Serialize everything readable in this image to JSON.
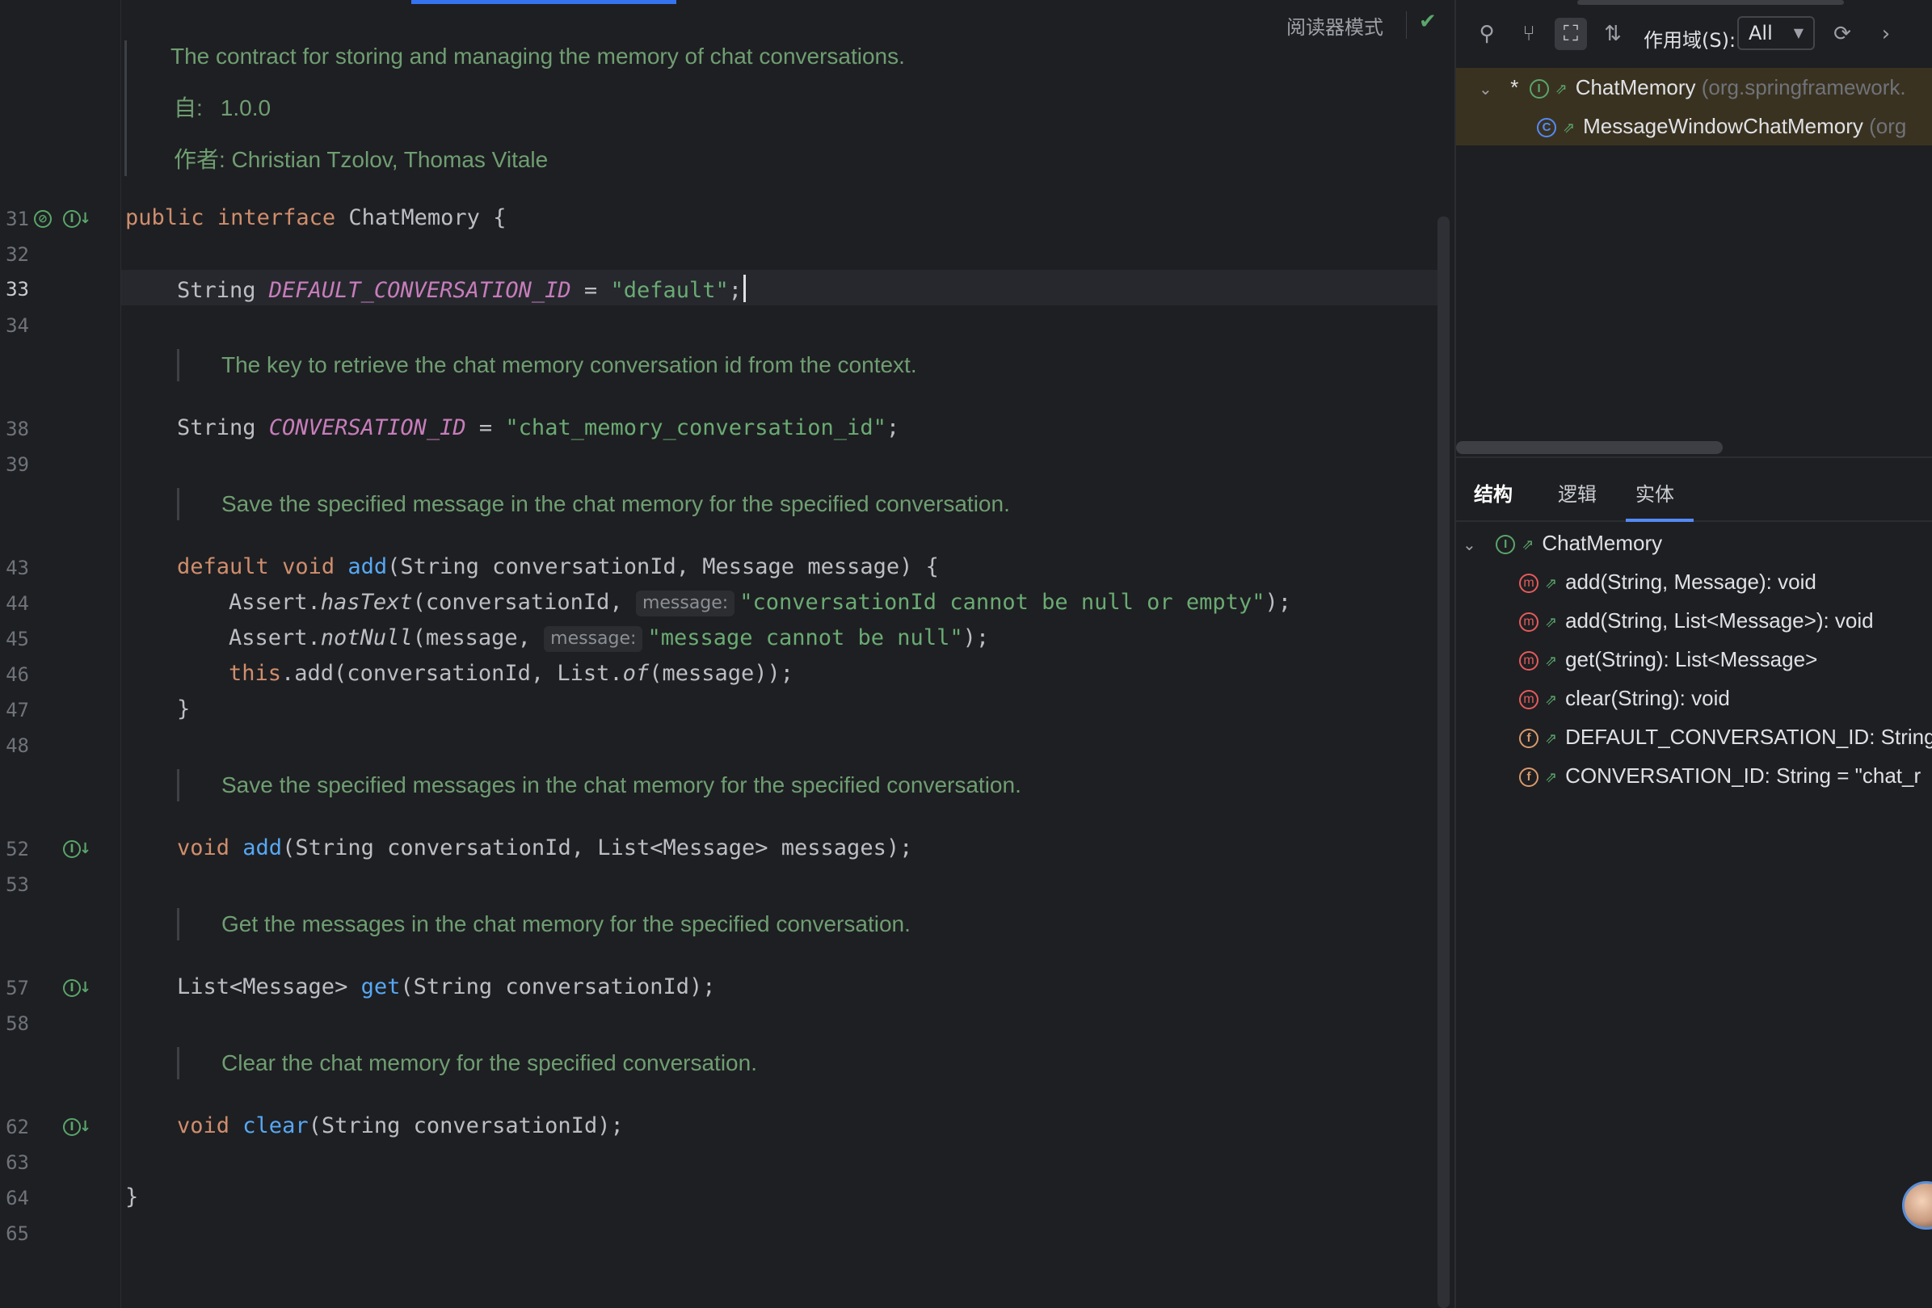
{
  "editor": {
    "reader_mode": "阅读器模式",
    "line_numbers": {
      "l31": "31",
      "l32": "32",
      "l33": "33",
      "l34": "34",
      "l38": "38",
      "l39": "39",
      "l43": "43",
      "l44": "44",
      "l45": "45",
      "l46": "46",
      "l47": "47",
      "l48": "48",
      "l52": "52",
      "l53": "53",
      "l57": "57",
      "l58": "58",
      "l62": "62",
      "l63": "63",
      "l64": "64",
      "l65": "65"
    },
    "doc_interface": {
      "description": "The contract for storing and managing the memory of chat conversations.",
      "since_label": "自:",
      "since_value": "1.0.0",
      "author_line": "作者: Christian Tzolov, Thomas Vitale"
    },
    "doc_conversation_id": "The key to retrieve the chat memory conversation id from the context.",
    "doc_add_single": "Save the specified message in the chat memory for the specified conversation.",
    "doc_add_list": "Save the specified messages in the chat memory for the specified conversation.",
    "doc_get": "Get the messages in the chat memory for the specified conversation.",
    "doc_clear": "Clear the chat memory for the specified conversation.",
    "code": {
      "l31_kw1": "public",
      "l31_kw2": "interface",
      "l31_rest": " ChatMemory {",
      "l33_type": "String ",
      "l33_const": "DEFAULT_CONVERSATION_ID",
      "l33_eq": " = ",
      "l33_str": "\"default\"",
      "l33_end": ";",
      "l38_type": "String ",
      "l38_const": "CONVERSATION_ID",
      "l38_eq": " = ",
      "l38_str": "\"chat_memory_conversation_id\"",
      "l38_end": ";",
      "l43_kw1": "default",
      "l43_kw2": "void",
      "l43_fn": "add",
      "l43_rest": "(String conversationId, Message message) {",
      "l44_a": "Assert.",
      "l44_m": "hasText",
      "l44_b": "(conversationId, ",
      "l44_hint": "message:",
      "l44_str": "\"conversationId cannot be null or empty\"",
      "l44_end": ");",
      "l45_a": "Assert.",
      "l45_m": "notNull",
      "l45_b": "(message, ",
      "l45_hint": "message:",
      "l45_str": "\"message cannot be null\"",
      "l45_end": ");",
      "l46_kw": "this",
      "l46_a": ".add(conversationId, List.",
      "l46_m": "of",
      "l46_b": "(message));",
      "l47": "}",
      "l52_kw": "void",
      "l52_fn": "add",
      "l52_rest": "(String conversationId, List<Message> messages);",
      "l57_a": "List<Message> ",
      "l57_fn": "get",
      "l57_rest": "(String conversationId);",
      "l62_kw": "void",
      "l62_fn": "clear",
      "l62_rest": "(String conversationId);",
      "l64": "}"
    }
  },
  "hierarchy": {
    "scope_label": "作用域(S):",
    "scope_value": "All",
    "root_marker": "*",
    "root_name": "ChatMemory",
    "root_package": "(org.springframework.",
    "child_name": "MessageWindowChatMemory",
    "child_package": "(org"
  },
  "structure": {
    "tabs": [
      "结构",
      "逻辑",
      "实体"
    ],
    "root": "ChatMemory",
    "members": [
      "add(String, Message): void",
      "add(String, List<Message>): void",
      "get(String): List<Message>",
      "clear(String): void",
      "DEFAULT_CONVERSATION_ID: String",
      "CONVERSATION_ID: String = \"chat_r"
    ]
  },
  "colors": {
    "accent": "#3574f0",
    "comment_green": "#6f9e72",
    "keyword": "#cf8e6d",
    "constant": "#c77dbb",
    "string": "#6aab73",
    "function": "#56a8f5"
  }
}
